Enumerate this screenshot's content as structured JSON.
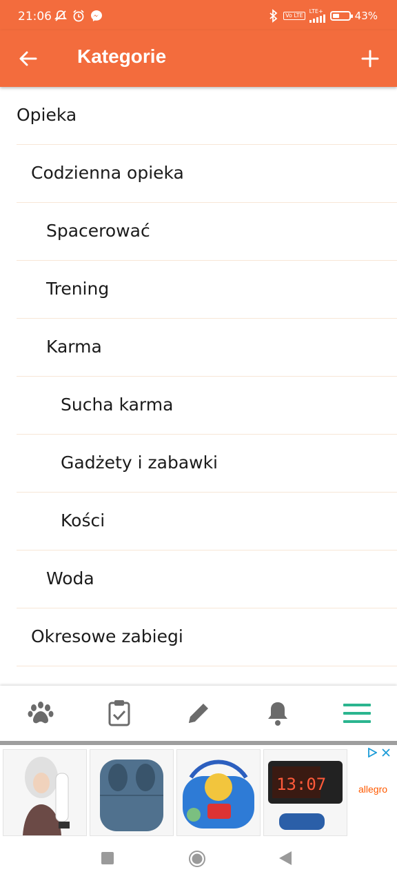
{
  "status_bar": {
    "time": "21:06",
    "volte": "Vo LTE",
    "lte": "LTE+",
    "battery_percent_text": "43%",
    "battery_level": 0.43,
    "icons": [
      "muted-notification-icon",
      "alarm-icon",
      "messenger-icon",
      "bluetooth-icon",
      "signal-icon",
      "battery-icon"
    ]
  },
  "app_bar": {
    "title": "Kategorie",
    "back_icon": "arrow-left-icon",
    "add_icon": "plus-icon",
    "background": "#f36c3d"
  },
  "categories": [
    {
      "label": "Opieka",
      "level": 0
    },
    {
      "label": "Codzienna opieka",
      "level": 1
    },
    {
      "label": "Spacerować",
      "level": 2
    },
    {
      "label": "Trening",
      "level": 2
    },
    {
      "label": "Karma",
      "level": 2
    },
    {
      "label": "Sucha karma",
      "level": 3
    },
    {
      "label": "Gadżety i zabawki",
      "level": 3
    },
    {
      "label": "Kości",
      "level": 3
    },
    {
      "label": "Woda",
      "level": 2
    },
    {
      "label": "Okresowe zabiegi",
      "level": 1
    }
  ],
  "bottom_nav": {
    "items": [
      {
        "icon": "paw-icon",
        "active": false
      },
      {
        "icon": "clipboard-check-icon",
        "active": false
      },
      {
        "icon": "pencil-icon",
        "active": false
      },
      {
        "icon": "bell-icon",
        "active": false
      },
      {
        "icon": "menu-icon",
        "active": true
      }
    ],
    "inactive_color": "#6b6b6b",
    "active_color": "#2bb58f"
  },
  "ad": {
    "brand": "allegro",
    "brand_color": "#ff5a00",
    "products": [
      "hooded-dryer-product",
      "earbuds-case-product",
      "kids-cd-player-product",
      "alarm-clock-product"
    ]
  },
  "system_nav": {
    "icons": [
      "recents-square-icon",
      "home-circle-icon",
      "back-triangle-icon"
    ]
  }
}
